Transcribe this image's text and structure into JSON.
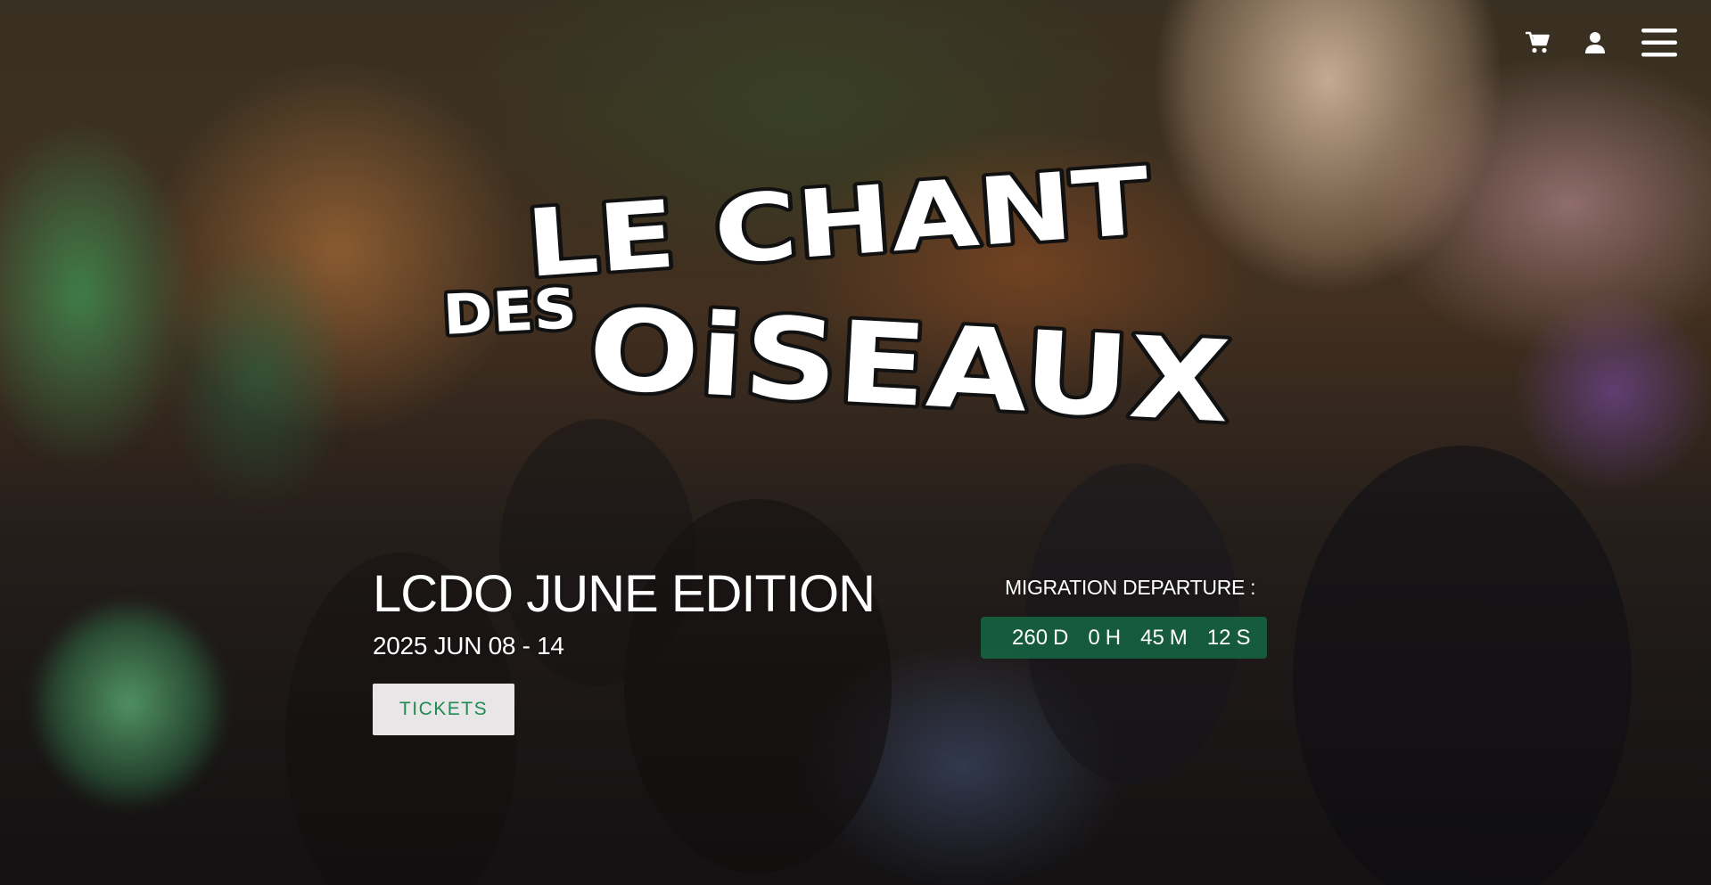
{
  "nav": {
    "cart_icon": "cart-icon",
    "user_icon": "user-icon",
    "menu_icon": "hamburger-menu-icon"
  },
  "logo": {
    "line1": "LE CHANT",
    "line2_prefix": "DES",
    "line2": "OiSEAUX"
  },
  "event": {
    "title": "LCDO JUNE EDITION",
    "dates": "2025 JUN 08 - 14",
    "tickets_label": "TICKETS"
  },
  "countdown": {
    "label": "MIGRATION DEPARTURE :",
    "days": "260",
    "days_suffix": "D",
    "hours": "0",
    "hours_suffix": "H",
    "minutes": "45",
    "minutes_suffix": "M",
    "seconds": "12",
    "seconds_suffix": "S"
  },
  "colors": {
    "accent_green": "#1f8a52",
    "countdown_bg": "#146e46",
    "text": "#ffffff"
  }
}
